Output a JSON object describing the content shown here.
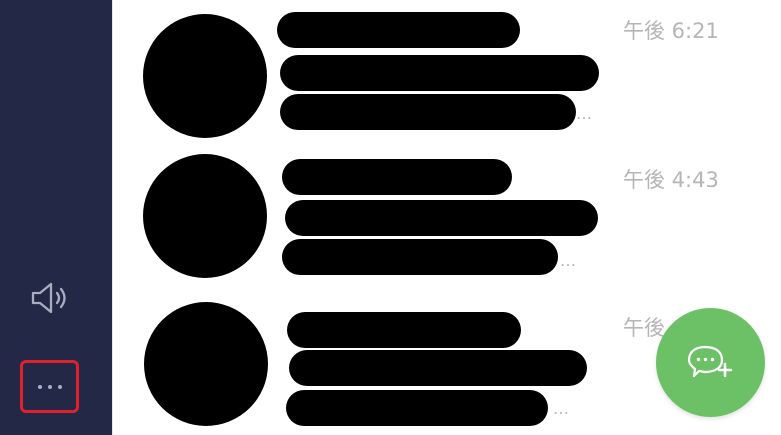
{
  "sidebar": {
    "speaker_icon": "speaker-icon",
    "more_icon": "more-icon",
    "more_highlight_color": "#e0202a",
    "background_color": "#222845"
  },
  "chats": [
    {
      "time": "午後 6:21"
    },
    {
      "time": "午後 4:43"
    },
    {
      "time": "午後"
    }
  ],
  "fab": {
    "icon": "new-chat-icon",
    "color": "#6cc167"
  }
}
